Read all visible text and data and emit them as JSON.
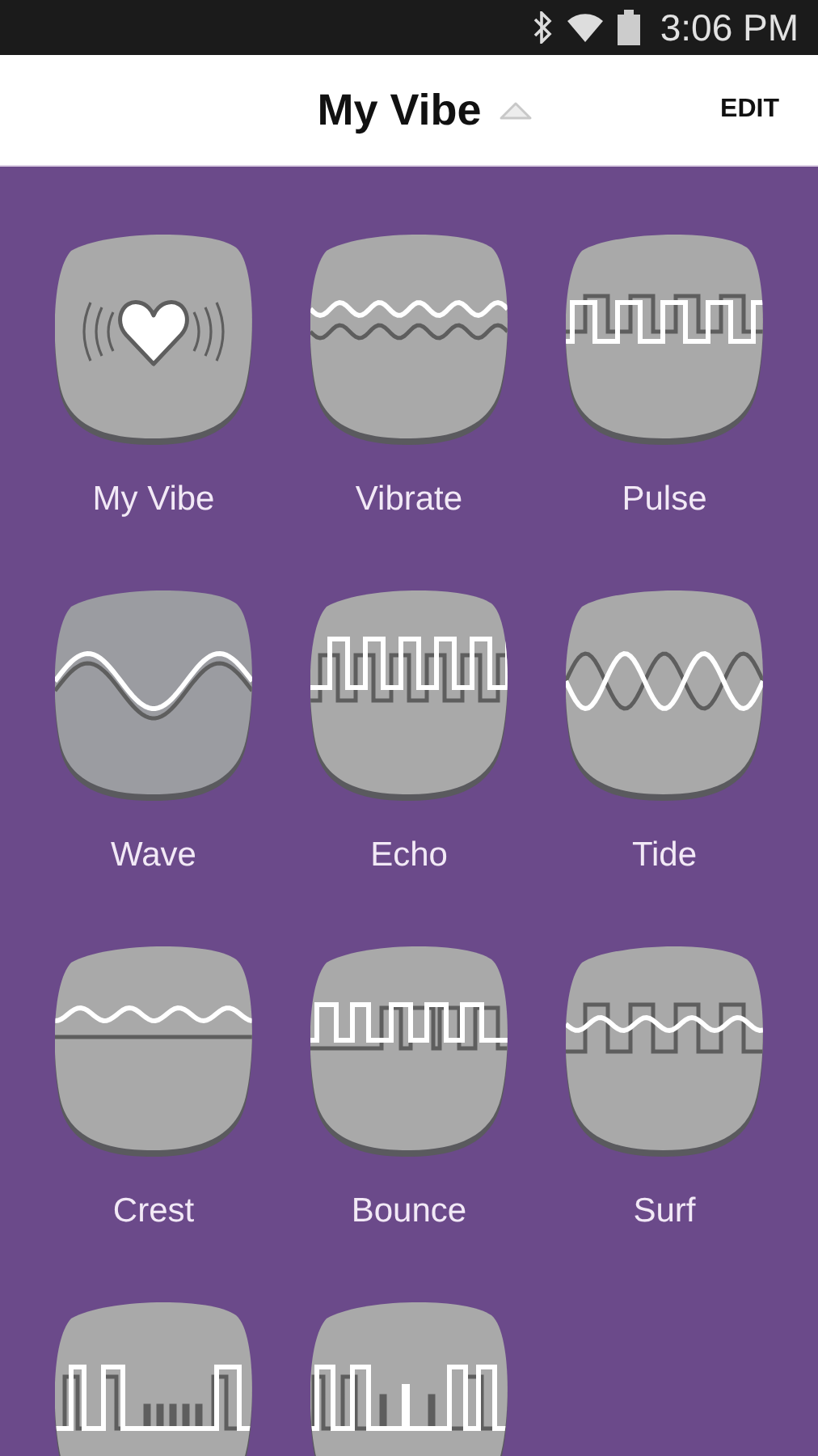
{
  "status_bar": {
    "time": "3:06 PM"
  },
  "header": {
    "title": "My Vibe",
    "action": "EDIT"
  },
  "pads": [
    {
      "label": "My Vibe",
      "kind": "heart",
      "selected": false
    },
    {
      "label": "Vibrate",
      "kind": "ripple",
      "selected": false
    },
    {
      "label": "Pulse",
      "kind": "square",
      "selected": false
    },
    {
      "label": "Wave",
      "kind": "sine",
      "selected": true
    },
    {
      "label": "Echo",
      "kind": "echo",
      "selected": false
    },
    {
      "label": "Tide",
      "kind": "tide",
      "selected": false
    },
    {
      "label": "Crest",
      "kind": "crest",
      "selected": false
    },
    {
      "label": "Bounce",
      "kind": "bounce",
      "selected": false
    },
    {
      "label": "Surf",
      "kind": "surf",
      "selected": false
    },
    {
      "kind": "burst",
      "selected": false
    },
    {
      "kind": "blip",
      "selected": false
    }
  ]
}
